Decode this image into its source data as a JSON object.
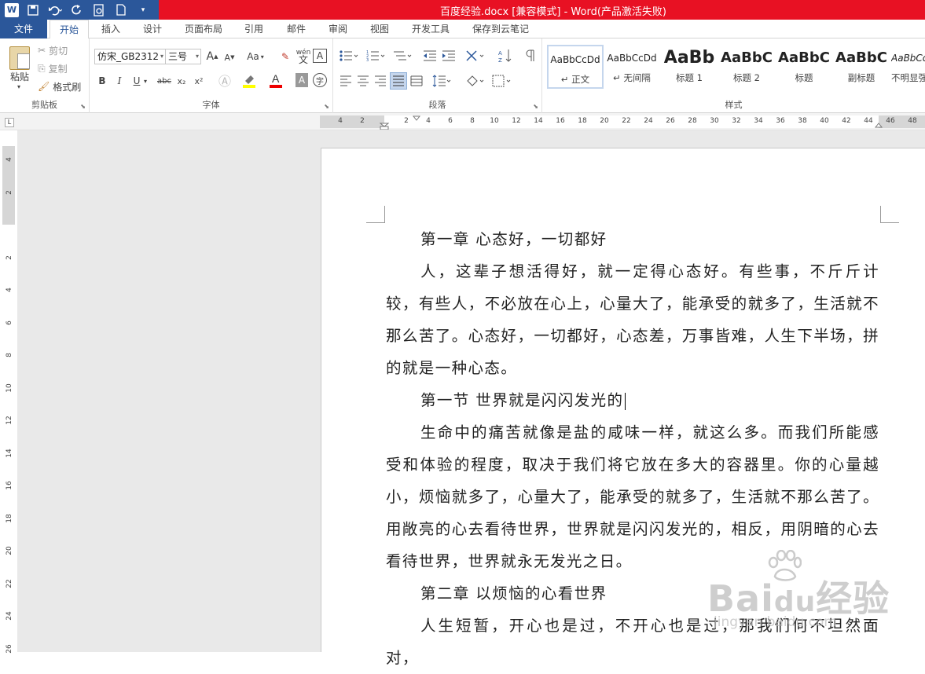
{
  "window": {
    "title": "百度经验.docx [兼容模式] - Word(产品激活失败)",
    "app_icon": "W"
  },
  "quick_access": [
    "save-icon",
    "undo-icon",
    "redo-icon",
    "print-preview-icon",
    "new-doc-icon",
    "customize-icon"
  ],
  "tabs": [
    "文件",
    "开始",
    "插入",
    "设计",
    "页面布局",
    "引用",
    "邮件",
    "审阅",
    "视图",
    "开发工具",
    "保存到云笔记"
  ],
  "active_tab": "开始",
  "clipboard": {
    "paste": "粘贴",
    "cut": "剪切",
    "copy": "复制",
    "format_painter": "格式刷",
    "label": "剪贴板"
  },
  "font": {
    "name": "仿宋_GB2312",
    "size": "三号",
    "label": "字体",
    "grow": "A",
    "shrink": "A",
    "case": "Aa",
    "phonetic": "wén",
    "bold": "B",
    "italic": "I",
    "underline": "U",
    "strike": "abc",
    "subscript": "x₂",
    "superscript": "x²",
    "char_border": "A",
    "char_shading": "A",
    "enclose": "字"
  },
  "paragraph": {
    "label": "段落"
  },
  "styles": {
    "label": "样式",
    "items": [
      {
        "sample": "AaBbCcDd",
        "name": "↵ 正文"
      },
      {
        "sample": "AaBbCcDd",
        "name": "↵ 无间隔"
      },
      {
        "sample": "AaBb",
        "name": "标题 1"
      },
      {
        "sample": "AaBbC",
        "name": "标题 2"
      },
      {
        "sample": "AaBbC",
        "name": "标题"
      },
      {
        "sample": "AaBbC",
        "name": "副标题"
      },
      {
        "sample": "AaBbCc",
        "name": "不明显强"
      }
    ]
  },
  "ruler": {
    "h_numbers": [
      "4",
      "2",
      "",
      "2",
      "4",
      "6",
      "8",
      "10",
      "12",
      "14",
      "16",
      "18",
      "20",
      "22",
      "24",
      "26",
      "28",
      "30",
      "32",
      "34",
      "36",
      "38",
      "40",
      "42",
      "44",
      "46",
      "48"
    ],
    "v_numbers": [
      "4",
      "2",
      "",
      "2",
      "4",
      "6",
      "8",
      "10",
      "12",
      "14",
      "16",
      "18",
      "20",
      "22",
      "24",
      "26"
    ]
  },
  "document": {
    "paragraphs": [
      {
        "type": "heading",
        "text": "第一章  心态好，一切都好"
      },
      {
        "type": "body",
        "text": "人，这辈子想活得好，就一定得心态好。有些事，不斤斤计较，有些人，不必放在心上，心量大了，能承受的就多了，生活就不那么苦了。心态好，一切都好，心态差，万事皆难，人生下半场，拼的就是一种心态。"
      },
      {
        "type": "heading",
        "text": "第一节  世界就是闪闪发光的"
      },
      {
        "type": "body",
        "text": "生命中的痛苦就像是盐的咸味一样，就这么多。而我们所能感受和体验的程度，取决于我们将它放在多大的容器里。你的心量越小，烦恼就多了，心量大了，能承受的就多了，生活就不那么苦了。用敞亮的心去看待世界，世界就是闪闪发光的，相反，用阴暗的心去看待世界，世界就永无发光之日。"
      },
      {
        "type": "heading",
        "text": "第二章  以烦恼的心看世界"
      },
      {
        "type": "body",
        "text": "人生短暂，开心也是过，不开心也是过，那我们何不坦然面对，"
      }
    ]
  },
  "watermark": {
    "brand": "Bai",
    "brand2": "du",
    "suffix": "经验",
    "url": "jingyan.baidu.com"
  }
}
